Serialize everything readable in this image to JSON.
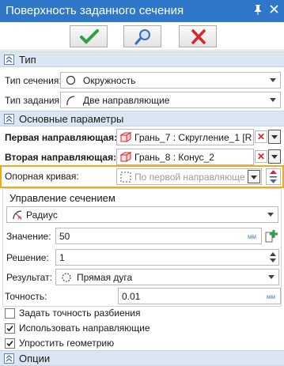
{
  "window": {
    "title": "Поверхность заданного сечения"
  },
  "toolbar": {
    "ok_icon": "check-icon",
    "preview_icon": "magnifier-icon",
    "cancel_icon": "close-icon"
  },
  "sections": {
    "type": {
      "label": "Тип"
    },
    "main": {
      "label": "Основные параметры"
    },
    "options": {
      "label": "Опции"
    }
  },
  "type_section": {
    "section_type_label": "Тип сечения:",
    "section_type_value": "Окружность",
    "spec_type_label": "Тип задания:",
    "spec_type_value": "Две направляющие"
  },
  "main_params": {
    "first_guide_label": "Первая направляющая:",
    "first_guide_value": "Грань_7 : Скругление_1 [R",
    "second_guide_label": "Вторая направляющая:",
    "second_guide_value": "Грань_8 : Конус_2",
    "ref_curve_label": "Опорная кривая:",
    "ref_curve_value": "По первой направляющей"
  },
  "section_control": {
    "title": "Управление сечением",
    "mode_value": "Радиус",
    "value_label": "Значение:",
    "value": "50",
    "value_unit": "мм",
    "solution_label": "Решение:",
    "solution": "1",
    "result_label": "Результат:",
    "result_value": "Прямая дуга"
  },
  "accuracy": {
    "label": "Точность:",
    "value": "0.01",
    "unit": "мм"
  },
  "checkboxes": [
    {
      "label": "Задать точность разбиения",
      "checked": false
    },
    {
      "label": "Использовать направляющие",
      "checked": true
    },
    {
      "label": "Упростить геометрию",
      "checked": true
    }
  ],
  "colors": {
    "title_bar": "#2f77c8",
    "ok_green": "#2ea043",
    "cancel_red": "#d4262c",
    "highlight_orange": "#f2a81d",
    "section_header": "#dce6f2"
  }
}
